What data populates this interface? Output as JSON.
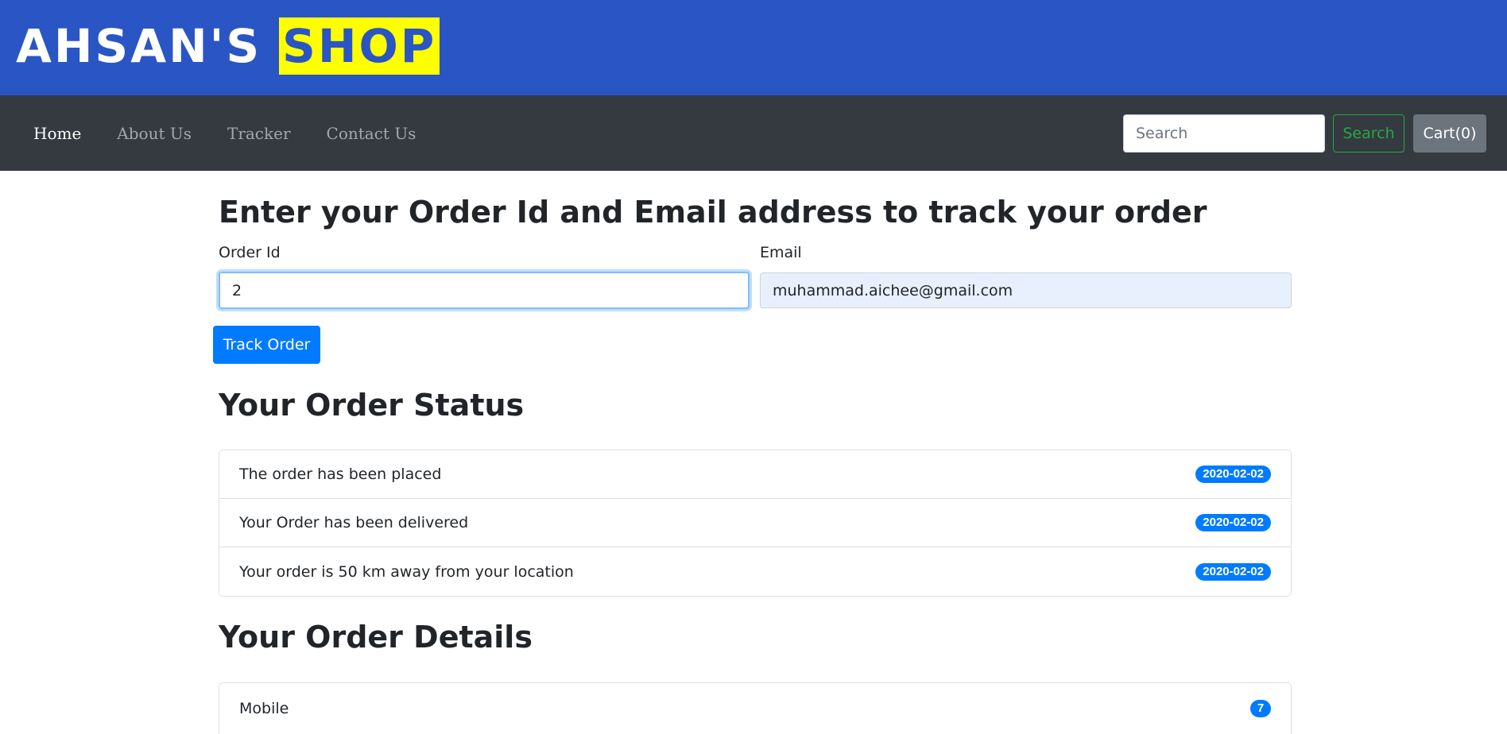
{
  "brand": {
    "name_part1": "AHSAN'S",
    "name_part2": "SHOP"
  },
  "nav": {
    "links": [
      {
        "label": "Home",
        "active": true
      },
      {
        "label": "About Us",
        "active": false
      },
      {
        "label": "Tracker",
        "active": false
      },
      {
        "label": "Contact Us",
        "active": false
      }
    ],
    "search_placeholder": "Search",
    "search_button": "Search",
    "cart_button": "Cart(0)"
  },
  "tracker": {
    "title": "Enter your Order Id and Email address to track your order",
    "order_id_label": "Order Id",
    "order_id_value": "2",
    "email_label": "Email",
    "email_value": "muhammad.aichee@gmail.com",
    "track_button": "Track Order"
  },
  "status": {
    "title": "Your Order Status",
    "items": [
      {
        "text": "The order has been placed",
        "date": "2020-02-02"
      },
      {
        "text": "Your Order has been delivered",
        "date": "2020-02-02"
      },
      {
        "text": "Your order is 50 km away from your location",
        "date": "2020-02-02"
      }
    ]
  },
  "details": {
    "title": "Your Order Details",
    "items": [
      {
        "name": "Mobile",
        "qty": "7"
      }
    ]
  },
  "colors": {
    "brand_bar": "#2a55c4",
    "brand_highlight": "#ffff00",
    "navbar": "#343a40",
    "primary": "#007bff",
    "success": "#28a745",
    "secondary": "#6c757d"
  }
}
